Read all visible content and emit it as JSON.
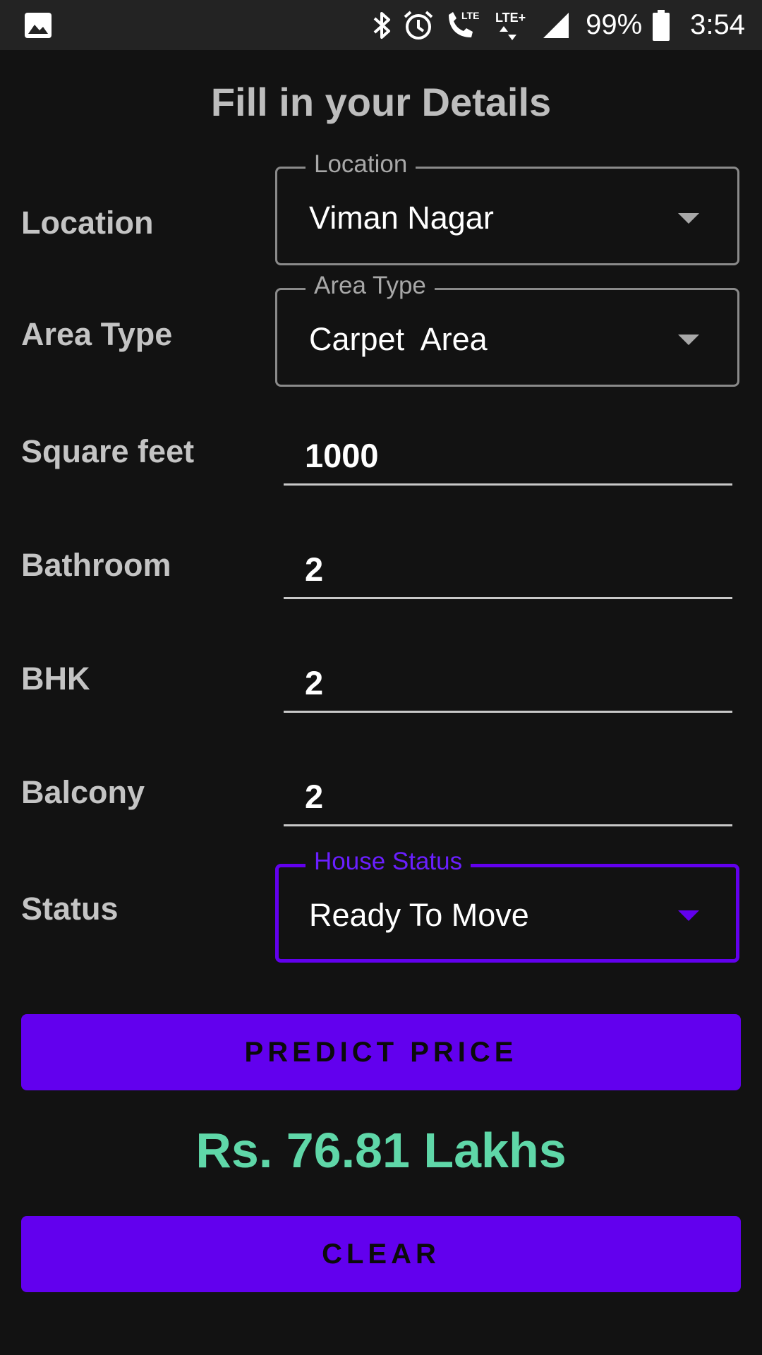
{
  "status_bar": {
    "battery_percent": "99%",
    "time": "3:54",
    "left_icon": "image-icon",
    "icons": [
      "bluetooth-icon",
      "alarm-icon",
      "volte-call-icon",
      "lte-plus-icon",
      "signal-icon",
      "battery-icon"
    ]
  },
  "title": "Fill in your Details",
  "form": {
    "location": {
      "label": "Location",
      "field_label": "Location",
      "value": "Viman Nagar"
    },
    "area_type": {
      "label": "Area Type",
      "field_label": "Area Type",
      "value": "Carpet  Area"
    },
    "square_feet": {
      "label": "Square feet",
      "value": "1000"
    },
    "bathroom": {
      "label": "Bathroom",
      "value": "2"
    },
    "bhk": {
      "label": "BHK",
      "value": "2"
    },
    "balcony": {
      "label": "Balcony",
      "value": "2"
    },
    "status": {
      "label": "Status",
      "field_label": "House Status",
      "value": "Ready To Move"
    }
  },
  "buttons": {
    "predict": "PREDICT PRICE",
    "clear": "CLEAR"
  },
  "result": "Rs. 76.81 Lakhs",
  "colors": {
    "background": "#121212",
    "accent": "#6200ee",
    "result": "#5fd7a8",
    "label": "#c4c4c4"
  }
}
